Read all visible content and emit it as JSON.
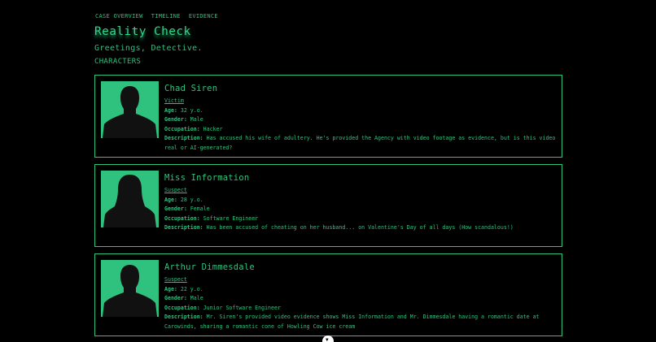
{
  "nav": {
    "items": [
      "CASE OVERVIEW",
      "TIMELINE",
      "EVIDENCE"
    ]
  },
  "header": {
    "title": "Reality Check",
    "greeting": "Greetings, Detective.",
    "section": "CHARACTERS"
  },
  "field_labels": {
    "age": "Age:",
    "gender": "Gender:",
    "occupation": "Occupation:",
    "description": "Description:"
  },
  "characters": [
    {
      "name": "Chad Siren",
      "role": "Victim",
      "age": "32 y.o.",
      "gender": "Male",
      "occupation": "Hacker",
      "description": "Has accused his wife of adultery. He's provided the Agency with video footage as evidence, but is this video real or AI-generated?",
      "silhouette": "male"
    },
    {
      "name": "Miss Information",
      "role": "Suspect",
      "age": "28 y.o.",
      "gender": "Female",
      "occupation": "Software Engineer",
      "description": "Has been accused of cheating on her husband... on Valentine's Day of all days (How scandalous!)",
      "silhouette": "female"
    },
    {
      "name": "Arthur Dimmesdale",
      "role": "Suspect",
      "age": "22 y.o.",
      "gender": "Male",
      "occupation": "Junior Software Engineer",
      "description": "Mr. Siren's provided video evidence shows Miss Information and Mr. Dimmesdale having a romantic date at Carowinds, sharing a romantic cone of Howling Cow ice cream",
      "silhouette": "male"
    }
  ],
  "scroll_button": {
    "icon": "chevron-down-icon",
    "glyph": "▼"
  },
  "colors": {
    "accent": "#2ec27e",
    "background": "#000000",
    "silhouette": "#111111"
  }
}
